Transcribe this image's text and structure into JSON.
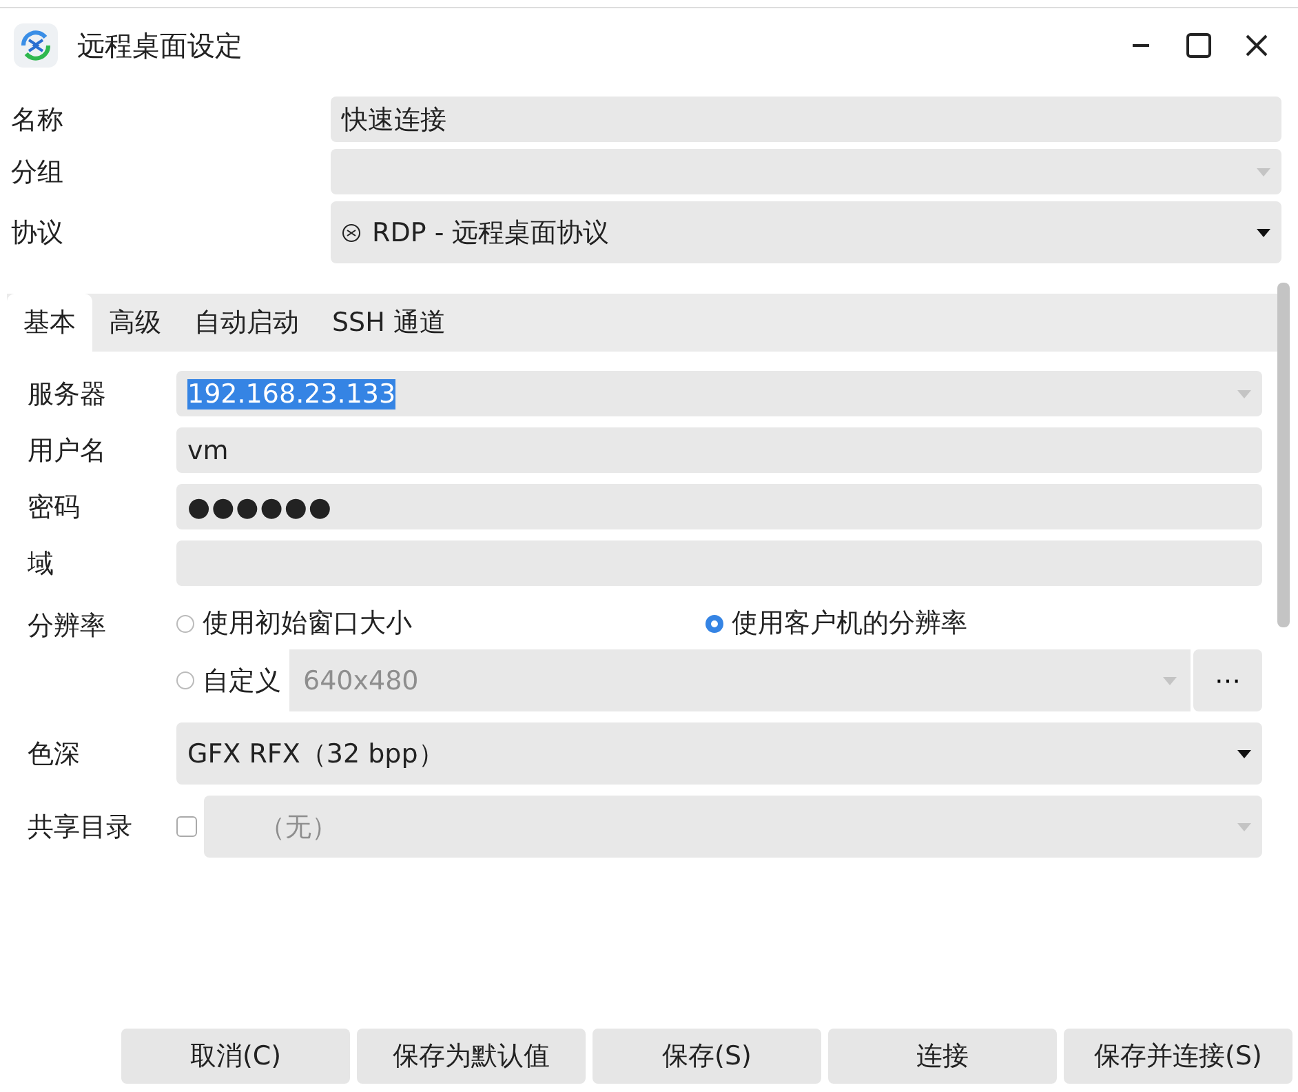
{
  "window": {
    "title": "远程桌面设定"
  },
  "name": {
    "label": "名称",
    "value": "快速连接"
  },
  "group": {
    "label": "分组"
  },
  "protocol": {
    "label": "协议",
    "value": "RDP - 远程桌面协议"
  },
  "tabs": [
    {
      "label": "基本",
      "selected": true
    },
    {
      "label": "高级",
      "selected": false
    },
    {
      "label": "自动启动",
      "selected": false
    },
    {
      "label": "SSH 通道",
      "selected": false
    }
  ],
  "server": {
    "label": "服务器",
    "value": "192.168.23.133",
    "selected": true
  },
  "username": {
    "label": "用户名",
    "value": "vm"
  },
  "password": {
    "label": "密码",
    "value": "●●●●●●"
  },
  "domain": {
    "label": "域"
  },
  "resolution": {
    "label": "分辨率",
    "options": [
      {
        "label": "使用初始窗口大小",
        "selected": false
      },
      {
        "label": "使用客户机的分辨率",
        "selected": true
      },
      {
        "label": "自定义",
        "selected": false
      }
    ],
    "custom_value": "640x480",
    "custom_disabled": true,
    "more_button": "⋯"
  },
  "color_depth": {
    "label": "色深",
    "value": "GFX RFX（32 bpp）"
  },
  "shared_folder": {
    "label": "共享目录",
    "checked": false,
    "value": "（无）",
    "disabled": true
  },
  "buttons": [
    "取消(C)",
    "保存为默认值",
    "保存(S)",
    "连接",
    "保存并连接(S)"
  ]
}
